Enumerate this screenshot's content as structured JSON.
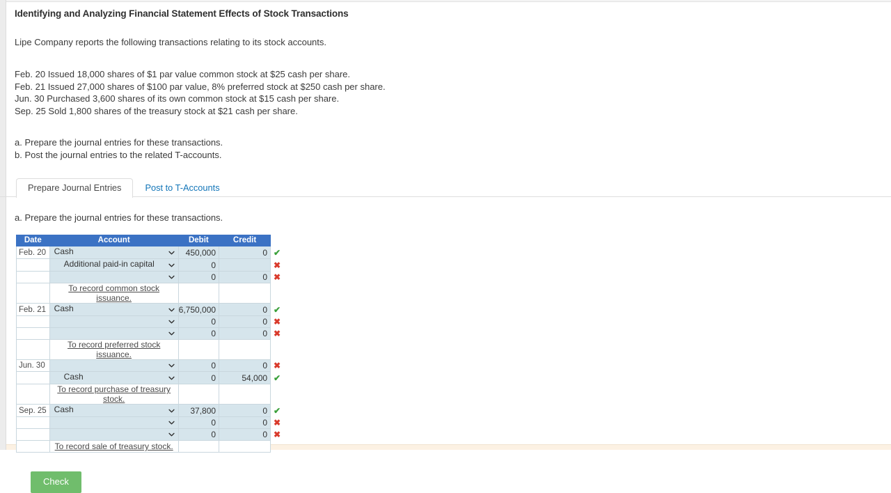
{
  "problem": {
    "title": "Identifying and Analyzing Financial Statement Effects of Stock Transactions",
    "intro": "Lipe Company reports the following transactions relating to its stock accounts.",
    "transactions": [
      "Feb. 20 Issued 18,000 shares of $1 par value common stock at $25 cash per share.",
      "Feb. 21 Issued 27,000 shares of $100 par value, 8% preferred stock at $250 cash per share.",
      "Jun. 30 Purchased 3,600 shares of its own common stock at $15 cash per share.",
      "Sep. 25 Sold 1,800 shares of the treasury stock at $21 cash per share."
    ],
    "requirements": [
      "a. Prepare the journal entries for these transactions.",
      "b. Post the journal entries to the related T-accounts."
    ]
  },
  "tabs": [
    {
      "label": "Prepare Journal Entries",
      "active": true
    },
    {
      "label": "Post to T-Accounts",
      "active": false
    }
  ],
  "sub_requirement": "a. Prepare the journal entries for these transactions.",
  "journal": {
    "columns": [
      "Date",
      "Account",
      "Debit",
      "Credit"
    ],
    "rows": [
      {
        "type": "entry",
        "date": "Feb. 20",
        "account": "Cash",
        "indent": false,
        "debit": "450,000",
        "credit": "0",
        "status": "correct"
      },
      {
        "type": "entry",
        "date": "",
        "account": "Additional paid-in capital",
        "indent": true,
        "debit": "0",
        "credit": "",
        "status": "incorrect"
      },
      {
        "type": "entry",
        "date": "",
        "account": "",
        "indent": false,
        "debit": "0",
        "credit": "0",
        "status": "incorrect"
      },
      {
        "type": "memo",
        "date": "",
        "memo": "To record common stock issuance.",
        "status": ""
      },
      {
        "type": "entry",
        "date": "Feb. 21",
        "account": "Cash",
        "indent": false,
        "debit": "6,750,000",
        "credit": "0",
        "status": "correct"
      },
      {
        "type": "entry",
        "date": "",
        "account": "",
        "indent": false,
        "debit": "0",
        "credit": "0",
        "status": "incorrect"
      },
      {
        "type": "entry",
        "date": "",
        "account": "",
        "indent": false,
        "debit": "0",
        "credit": "0",
        "status": "incorrect"
      },
      {
        "type": "memo",
        "date": "",
        "memo": "To record preferred stock issuance.",
        "status": ""
      },
      {
        "type": "entry",
        "date": "Jun. 30",
        "account": "",
        "indent": false,
        "debit": "0",
        "credit": "0",
        "status": "incorrect"
      },
      {
        "type": "entry",
        "date": "",
        "account": "Cash",
        "indent": true,
        "debit": "0",
        "credit": "54,000",
        "status": "correct"
      },
      {
        "type": "memo",
        "date": "",
        "memo": "To record purchase of treasury stock.",
        "status": ""
      },
      {
        "type": "entry",
        "date": "Sep. 25",
        "account": "Cash",
        "indent": false,
        "debit": "37,800",
        "credit": "0",
        "status": "correct"
      },
      {
        "type": "entry",
        "date": "",
        "account": "",
        "indent": false,
        "debit": "0",
        "credit": "0",
        "status": "incorrect"
      },
      {
        "type": "entry",
        "date": "",
        "account": "",
        "indent": false,
        "debit": "0",
        "credit": "0",
        "status": "incorrect"
      },
      {
        "type": "memo",
        "date": "",
        "memo": "To record sale of treasury stock.",
        "status": ""
      }
    ]
  },
  "actions": {
    "check_label": "Check"
  },
  "icons": {
    "correct": "✔",
    "incorrect": "✖",
    "chevron": "chevron-down-icon"
  },
  "colors": {
    "header_blue": "#3b72c4",
    "row_blue": "#d6e5ec",
    "check_green": "#70bd6c",
    "correct_green": "#3aa03a",
    "incorrect_red": "#d93a2b",
    "tab_link": "#1275b8"
  }
}
